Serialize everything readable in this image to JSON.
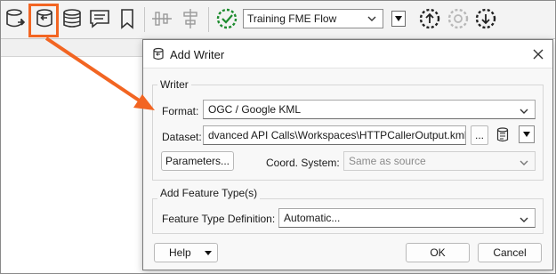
{
  "toolbar": {
    "icons": [
      "add-reader-icon",
      "add-writer-icon",
      "add-feature-type-icon",
      "annotation-icon",
      "bookmark-icon",
      "align-horizontal-icon",
      "align-vertical-icon",
      "connection-status-icon",
      "publish-icon",
      "sync-icon",
      "download-icon"
    ],
    "server_selected": "Training FME Flow"
  },
  "dialog": {
    "title": "Add Writer",
    "writer_group": "Writer",
    "format_label": "Format:",
    "format_value": "OGC / Google KML",
    "dataset_label": "Dataset:",
    "dataset_value": "dvanced API Calls\\Workspaces\\HTTPCallerOutput.kml\"",
    "browse_label": "...",
    "parameters_label": "Parameters...",
    "coord_label": "Coord. System:",
    "coord_placeholder": "Same as source",
    "feature_group": "Add Feature Type(s)",
    "ftd_label": "Feature Type Definition:",
    "ftd_value": "Automatic...",
    "help_label": "Help",
    "ok_label": "OK",
    "cancel_label": "Cancel"
  },
  "colors": {
    "highlight": "#f26522",
    "status_green": "#1e8c2f"
  }
}
